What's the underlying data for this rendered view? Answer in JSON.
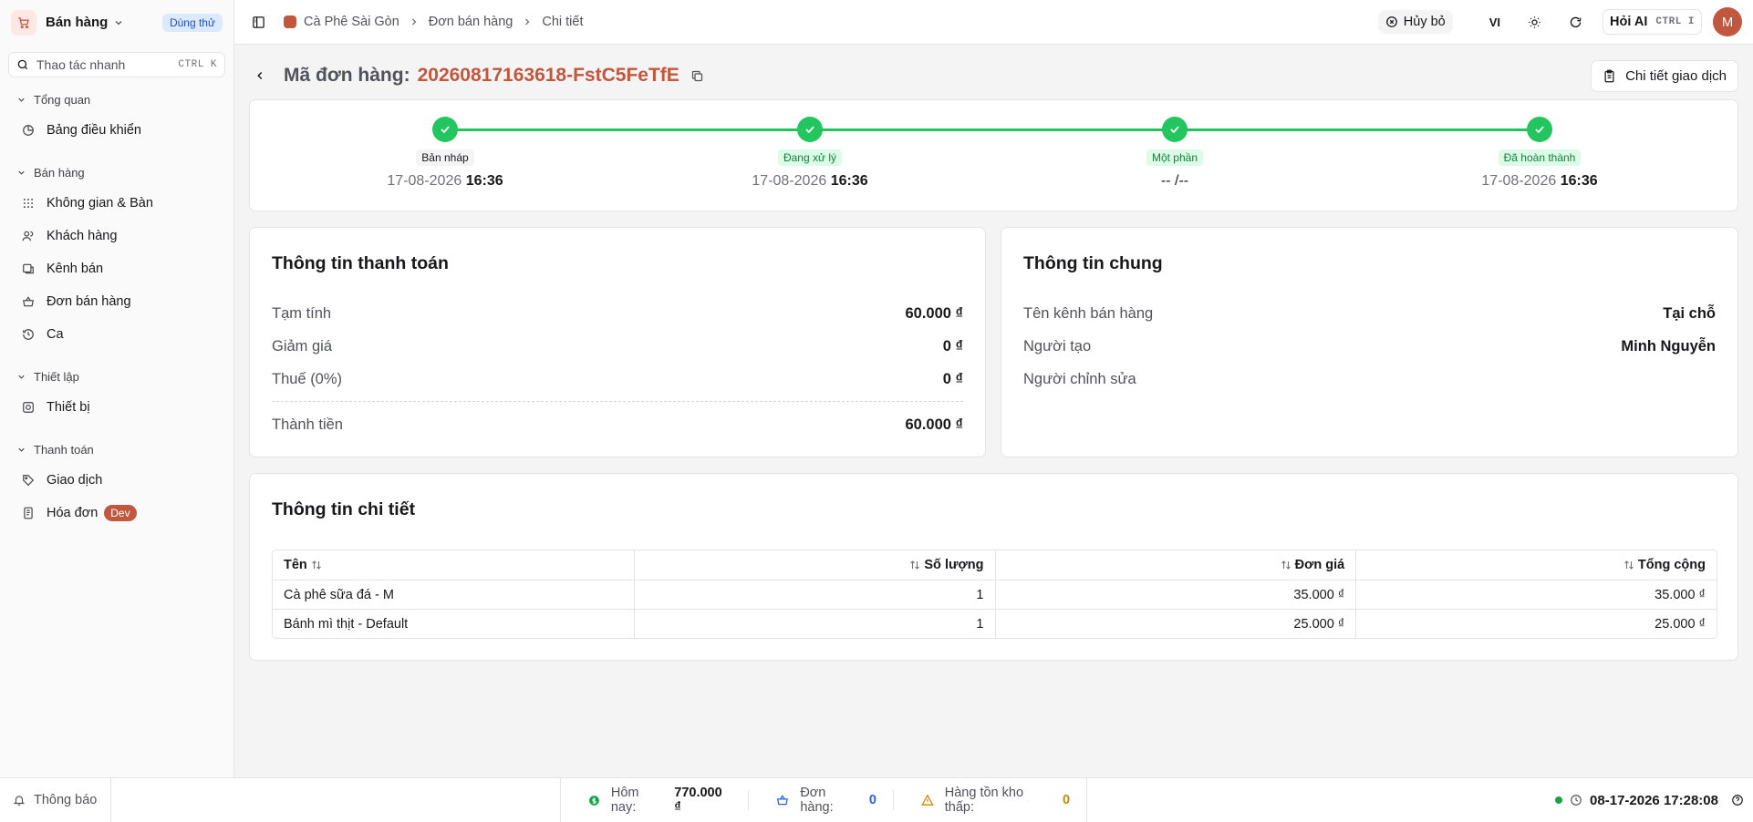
{
  "sidebar": {
    "app_name": "Bán hàng",
    "trial_badge": "Dùng thử",
    "search_placeholder": "Thao tác nhanh",
    "search_shortcut": "CTRL K",
    "groups": [
      {
        "title": "Tổng quan",
        "items": [
          {
            "label": "Bảng điều khiển",
            "icon": "dashboard-icon"
          }
        ]
      },
      {
        "title": "Bán hàng",
        "items": [
          {
            "label": "Không gian & Bàn",
            "icon": "grid-icon"
          },
          {
            "label": "Khách hàng",
            "icon": "users-icon"
          },
          {
            "label": "Kênh bán",
            "icon": "channel-icon"
          },
          {
            "label": "Đơn bán hàng",
            "icon": "basket-icon"
          },
          {
            "label": "Ca",
            "icon": "history-icon"
          }
        ]
      },
      {
        "title": "Thiết lập",
        "items": [
          {
            "label": "Thiết bị",
            "icon": "device-icon"
          }
        ]
      },
      {
        "title": "Thanh toán",
        "items": [
          {
            "label": "Giao dịch",
            "icon": "tag-icon"
          },
          {
            "label": "Hóa đơn",
            "icon": "invoice-icon",
            "badge": "Dev"
          }
        ]
      }
    ]
  },
  "topbar": {
    "breadcrumb": [
      "Cà Phê Sài Gòn",
      "Đơn bán hàng",
      "Chi tiết"
    ],
    "cancel_label": "Hủy bỏ",
    "lang": "VI",
    "ai_label": "Hỏi AI",
    "ai_shortcut": "CTRL I",
    "avatar_initial": "M"
  },
  "order": {
    "label": "Mã đơn hàng:",
    "code": "20260817163618-FstC5FeTfE",
    "transaction_button": "Chi tiết giao dịch"
  },
  "steps": [
    {
      "label": "Bản nháp",
      "style": "gray",
      "date": "17-08-2026",
      "time": "16:36"
    },
    {
      "label": "Đang xử lý",
      "style": "green",
      "date": "17-08-2026",
      "time": "16:36"
    },
    {
      "label": "Một phần",
      "style": "green",
      "date": "-- /--",
      "time": ""
    },
    {
      "label": "Đã hoàn thành",
      "style": "green",
      "date": "17-08-2026",
      "time": "16:36"
    }
  ],
  "payment": {
    "title": "Thông tin thanh toán",
    "rows": [
      {
        "key": "Tạm tính",
        "value": "60.000 ₫"
      },
      {
        "key": "Giảm giá",
        "value": "0 ₫"
      },
      {
        "key": "Thuế (0%)",
        "value": "0 ₫"
      }
    ],
    "total": {
      "key": "Thành tiền",
      "value": "60.000 ₫"
    }
  },
  "general": {
    "title": "Thông tin chung",
    "rows": [
      {
        "key": "Tên kênh bán hàng",
        "value": "Tại chỗ"
      },
      {
        "key": "Người tạo",
        "value": "Minh Nguyễn"
      },
      {
        "key": "Người chỉnh sửa",
        "value": ""
      }
    ]
  },
  "details": {
    "title": "Thông tin chi tiết",
    "columns": [
      "Tên",
      "Số lượng",
      "Đơn giá",
      "Tổng cộng"
    ],
    "rows": [
      [
        "Cà phê sữa đá - M",
        "1",
        "35.000 ₫",
        "35.000 ₫"
      ],
      [
        "Bánh mì thịt - Default",
        "1",
        "25.000 ₫",
        "25.000 ₫"
      ]
    ]
  },
  "statusbar": {
    "notifications": "Thông báo",
    "today_label": "Hôm nay:",
    "today_value": "770.000 ₫",
    "orders_label": "Đơn hàng:",
    "orders_value": "0",
    "low_stock_label": "Hàng tồn kho thấp:",
    "low_stock_value": "0",
    "datetime": "08-17-2026 17:28:08"
  },
  "colors": {
    "accent": "#c2573f",
    "success": "#22c55e",
    "info": "#2563eb",
    "warning": "#ca8a04"
  }
}
